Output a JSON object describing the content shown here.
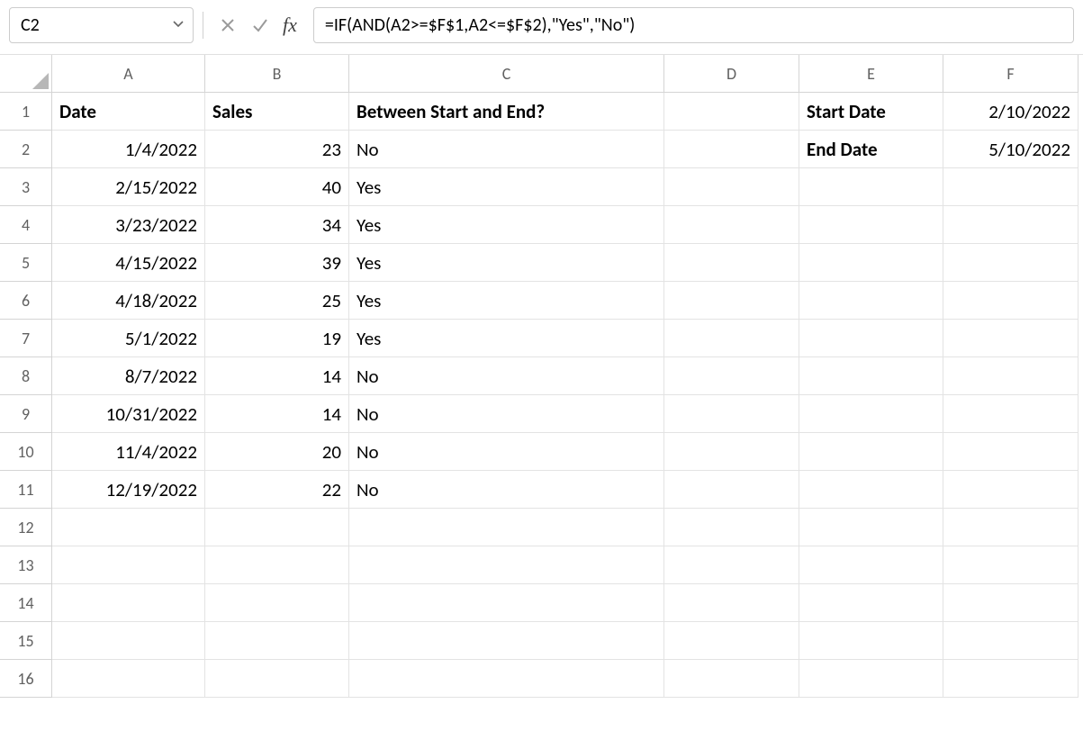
{
  "name_box": "C2",
  "formula": "=IF(AND(A2>=$F$1,A2<=$F$2),\"Yes\",\"No\")",
  "columns": [
    "A",
    "B",
    "C",
    "D",
    "E",
    "F"
  ],
  "row_numbers": [
    "1",
    "2",
    "3",
    "4",
    "5",
    "6",
    "7",
    "8",
    "9",
    "10",
    "11",
    "12",
    "13",
    "14",
    "15",
    "16"
  ],
  "headers": {
    "date": "Date",
    "sales": "Sales",
    "between": "Between Start and End?",
    "start_date_label": "Start Date",
    "end_date_label": "End Date"
  },
  "start_date": "2/10/2022",
  "end_date": "5/10/2022",
  "rows": [
    {
      "date": "1/4/2022",
      "sales": "23",
      "between": "No"
    },
    {
      "date": "2/15/2022",
      "sales": "40",
      "between": "Yes"
    },
    {
      "date": "3/23/2022",
      "sales": "34",
      "between": "Yes"
    },
    {
      "date": "4/15/2022",
      "sales": "39",
      "between": "Yes"
    },
    {
      "date": "4/18/2022",
      "sales": "25",
      "between": "Yes"
    },
    {
      "date": "5/1/2022",
      "sales": "19",
      "between": "Yes"
    },
    {
      "date": "8/7/2022",
      "sales": "14",
      "between": "No"
    },
    {
      "date": "10/31/2022",
      "sales": "14",
      "between": "No"
    },
    {
      "date": "11/4/2022",
      "sales": "20",
      "between": "No"
    },
    {
      "date": "12/19/2022",
      "sales": "22",
      "between": "No"
    }
  ]
}
